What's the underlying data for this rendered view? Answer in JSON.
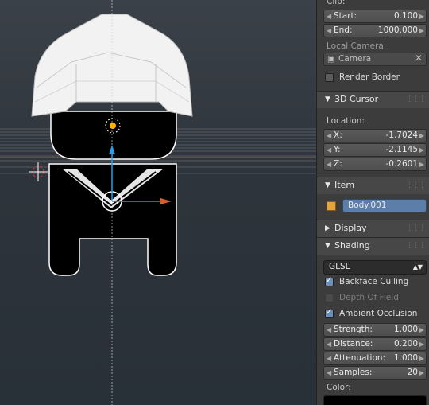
{
  "viewport": {
    "colors": {
      "outline": "#ffffff",
      "grid": "#8a8f96",
      "x_arrow": "#e05a2a",
      "z_arrow": "#2aa0e8",
      "lamp": "#ffb000"
    }
  },
  "properties": {
    "clip": {
      "label": "Clip:",
      "start_label": "Start:",
      "start_value": "0.100",
      "end_label": "End:",
      "end_value": "1000.000"
    },
    "local_camera": {
      "label": "Local Camera:",
      "value": "Camera",
      "clear_icon": "close-icon"
    },
    "render_border": {
      "label": "Render Border",
      "checked": false
    },
    "cursor_panel": {
      "title": "3D Cursor",
      "location_label": "Location:",
      "x_label": "X:",
      "x_value": "-1.7024",
      "y_label": "Y:",
      "y_value": "-2.1145",
      "z_label": "Z:",
      "z_value": "-0.2601"
    },
    "item_panel": {
      "title": "Item",
      "object_name": "Body.001"
    },
    "display_panel": {
      "title": "Display"
    },
    "shading_panel": {
      "title": "Shading",
      "mode": "GLSL",
      "backface_culling": {
        "label": "Backface Culling",
        "checked": true
      },
      "depth_of_field": {
        "label": "Depth Of Field",
        "checked": false
      },
      "ambient_occlusion": {
        "label": "Ambient Occlusion",
        "checked": true
      },
      "strength_label": "Strength:",
      "strength_value": "1.000",
      "distance_label": "Distance:",
      "distance_value": "0.200",
      "attenuation_label": "Attenuation:",
      "attenuation_value": "1.000",
      "samples_label": "Samples:",
      "samples_value": "20",
      "color_label": "Color:"
    }
  }
}
